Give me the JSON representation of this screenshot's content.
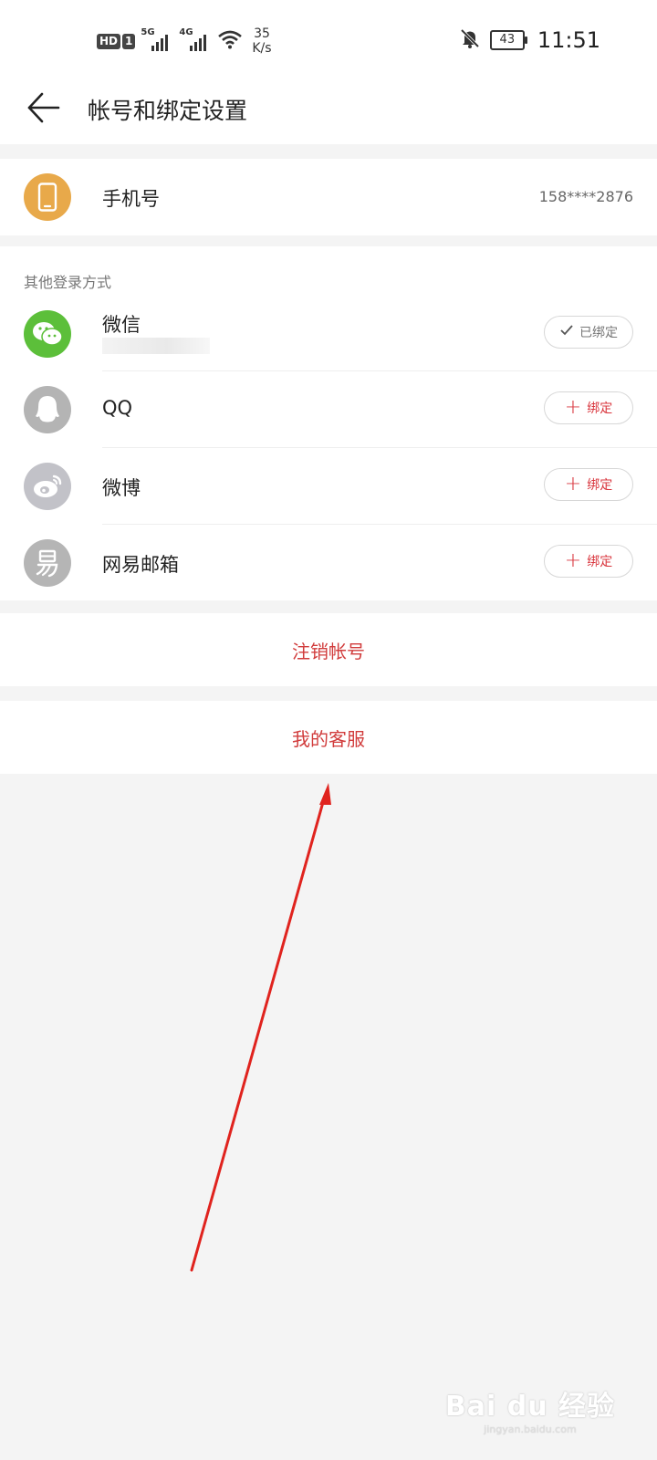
{
  "status_bar": {
    "hd": "HD",
    "sim": "1",
    "net1": "5G",
    "net2": "4G",
    "speed_value": "35",
    "speed_unit": "K/s",
    "battery": "43",
    "time": "11:51",
    "icons": [
      "signal-icon",
      "wifi-icon",
      "mute-bell-icon",
      "battery-icon"
    ]
  },
  "header": {
    "title": "帐号和绑定设置",
    "back_icon": "arrow-left-icon"
  },
  "phone": {
    "label": "手机号",
    "value": "158****2876",
    "icon": "smartphone-icon",
    "icon_color": "#e8a94a"
  },
  "other_logins": {
    "section_label": "其他登录方式",
    "items": [
      {
        "label": "微信",
        "icon": "wechat-icon",
        "color": "#5cbf3a",
        "action": "已绑定",
        "bound": true
      },
      {
        "label": "QQ",
        "icon": "qq-icon",
        "color": "#b4b4b4",
        "action": "绑定",
        "bound": false
      },
      {
        "label": "微博",
        "icon": "weibo-icon",
        "color": "#c2c2c8",
        "action": "绑定",
        "bound": false
      },
      {
        "label": "网易邮箱",
        "icon": "netease-mail-icon",
        "color": "#b5b5b5",
        "action": "绑定",
        "bound": false
      }
    ]
  },
  "actions": {
    "deregister": "注销帐号",
    "customer_service": "我的客服"
  },
  "accent_color": "#d13c3c",
  "watermark": {
    "text": "Bai du 经验",
    "sub": "jingyan.baidu.com"
  }
}
